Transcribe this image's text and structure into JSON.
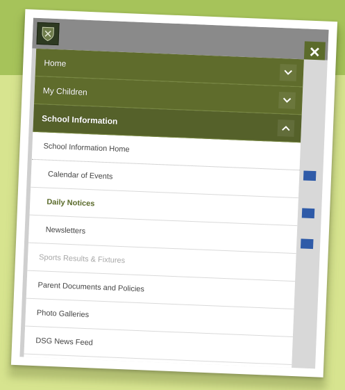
{
  "menu": {
    "close_label": "✕",
    "top_items": [
      {
        "label": "Home"
      },
      {
        "label": "My Children"
      },
      {
        "label": "School Information"
      }
    ],
    "sub_items": [
      {
        "label": "School Information Home"
      },
      {
        "label": "Calendar of Events"
      },
      {
        "label": "Daily Notices"
      },
      {
        "label": "Newsletters"
      },
      {
        "label": "Sports Results & Fixtures"
      },
      {
        "label": "Parent Documents and Policies"
      },
      {
        "label": "Photo Galleries"
      },
      {
        "label": "DSG News Feed"
      }
    ]
  },
  "icons": {
    "logo": "school-crest-icon",
    "close": "close-icon",
    "expand": "chevron-down-icon",
    "collapse": "chevron-up-icon"
  },
  "colors": {
    "menu_green": "#5f6c2c",
    "close_green": "#5b6b2b",
    "page_background": "#d7e48f",
    "band": "#a6c35a"
  }
}
